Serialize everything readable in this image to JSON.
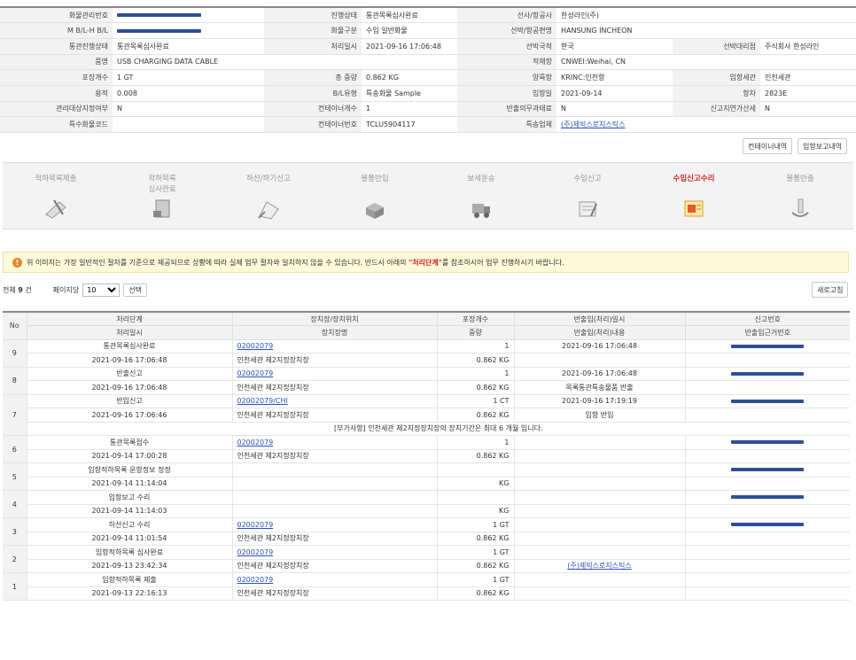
{
  "info": {
    "rows": [
      [
        {
          "l": "화물관리번호",
          "v": "",
          "redact": true
        },
        {
          "l": "진행상태",
          "v": "통관목록심사완료"
        },
        {
          "l": "선사/항공사",
          "v": "한성라인(주)",
          "span": 3
        }
      ],
      [
        {
          "l": "M B/L-H B/L",
          "v": "",
          "redact": true
        },
        {
          "l": "화물구분",
          "v": "수입 일반화물"
        },
        {
          "l": "선박/항공편명",
          "v": "HANSUNG INCHEON",
          "span": 3
        }
      ],
      [
        {
          "l": "통관진행상태",
          "v": "통관목록심사완료"
        },
        {
          "l": "처리일시",
          "v": "2021-09-16 17:06:48"
        },
        {
          "l": "선박국적",
          "v": "한국"
        },
        {
          "l": "선박대리점",
          "v": "주식회사 한성라인"
        }
      ],
      [
        {
          "l": "품명",
          "v": "USB CHARGING DATA CABLE",
          "span": 3
        },
        {
          "l": "적재항",
          "v": "CNWEI:Weihai, CN",
          "span": 3
        }
      ],
      [
        {
          "l": "포장개수",
          "v": "1 GT"
        },
        {
          "l": "총 중량",
          "v": "0.862 KG"
        },
        {
          "l": "양륙항",
          "v": "KRINC:인천항"
        },
        {
          "l": "입항세관",
          "v": "인천세관"
        }
      ],
      [
        {
          "l": "용적",
          "v": "0.008"
        },
        {
          "l": "B/L유형",
          "v": "특송화물 Sample"
        },
        {
          "l": "입항일",
          "v": "2021-09-14"
        },
        {
          "l": "항차",
          "v": "2823E"
        }
      ],
      [
        {
          "l": "관리대상지정여부",
          "v": "N"
        },
        {
          "l": "컨테이너개수",
          "v": "1"
        },
        {
          "l": "반출의무과태료",
          "v": "N"
        },
        {
          "l": "신고지연가산세",
          "v": "N"
        }
      ],
      [
        {
          "l": "특수화물코드",
          "v": ""
        },
        {
          "l": "컨테이너번호",
          "v": "TCLU5904117"
        },
        {
          "l": "특송업체",
          "v": "(주)제빅스로지스틱스",
          "link": true,
          "span": 3
        }
      ]
    ]
  },
  "buttons": {
    "container": "컨테이너내역",
    "entry": "입항보고내역",
    "refresh": "새로고침",
    "select": "선택"
  },
  "steps": [
    {
      "label": "적하목록제출",
      "icon": "pen-paper-icon"
    },
    {
      "label": "적하목록\n심사완료",
      "icon": "document-stamp-icon"
    },
    {
      "label": "하선/하기신고",
      "icon": "hand-paper-icon"
    },
    {
      "label": "물품반입",
      "icon": "box-stack-icon"
    },
    {
      "label": "보세운송",
      "icon": "truck-icon"
    },
    {
      "label": "수입신고",
      "icon": "form-pen-icon"
    },
    {
      "label": "수입신고수리",
      "icon": "accepted-stamp-icon",
      "active": true
    },
    {
      "label": "물품반출",
      "icon": "hand-doc-icon"
    }
  ],
  "notice": {
    "prefix": "위 이미지는 가장 일반적인 절차를 기준으로 제공되므로 상황에 따라 실제 업무 절차와 일치하지 않을 수 있습니다. 반드시 아래의 ",
    "highlight": "\"처리단계\"",
    "suffix": "를 참조하시어 업무 진행하시기 바랍니다."
  },
  "pager": {
    "total_prefix": "전체",
    "total": "9",
    "total_suffix": "건",
    "per_page_label": "페이지당",
    "per_page": "10"
  },
  "grid": {
    "headers_top": [
      "No",
      "처리단계",
      "장치장/장치위치",
      "포장개수",
      "반출입(처리)일시",
      "신고번호"
    ],
    "headers_bottom": [
      "처리일시",
      "장치장명",
      "중량",
      "반출입(처리)내용",
      "반출입근거번호"
    ],
    "records": [
      {
        "no": "9",
        "stage": "통관목록심사완료",
        "time": "2021-09-16 17:06:48",
        "loc": "02002079",
        "locname": "인천세관 제2지정장치장",
        "pkg": "1",
        "weight": "0.862 KG",
        "io_time": "2021-09-16 17:06:48",
        "io_desc": "",
        "decl": true,
        "basis": ""
      },
      {
        "no": "8",
        "stage": "반출신고",
        "time": "2021-09-16 17:06:48",
        "loc": "02002079",
        "locname": "인천세관 제2지정장치장",
        "pkg": "1",
        "weight": "0.862 KG",
        "io_time": "2021-09-16 17:06:48",
        "io_desc": "목록통관특송물품 반출",
        "decl": true,
        "basis": "",
        "redact2": true
      },
      {
        "no": "7",
        "stage": "반입신고",
        "time": "2021-09-16 17:06:46",
        "loc": "02002079/CHI",
        "locname": "인천세관 제2지정장치장",
        "pkg": "1 CT",
        "weight": "0.862 KG",
        "io_time": "2021-09-16 17:19:19",
        "io_desc": "입항 반입",
        "decl": true,
        "basis": "",
        "redact2": true,
        "extra": "[부가사항] 인천세관 제2지정장치장의 장치기간은 최대 6 개월 입니다."
      },
      {
        "no": "6",
        "stage": "통관목록접수",
        "time": "2021-09-14 17:00:28",
        "loc": "02002079",
        "locname": "인천세관 제2지정장치장",
        "pkg": "1",
        "weight": "0.862 KG",
        "io_time": "",
        "io_desc": "",
        "decl": true,
        "basis": ""
      },
      {
        "no": "5",
        "stage": "입항적하목록 운항정보 정정",
        "time": "2021-09-14 11:14:04",
        "loc": "",
        "locname": "",
        "pkg": "",
        "weight": "KG",
        "io_time": "",
        "io_desc": "",
        "decl": true,
        "basis": ""
      },
      {
        "no": "4",
        "stage": "입항보고 수리",
        "time": "2021-09-14 11:14:03",
        "loc": "",
        "locname": "",
        "pkg": "",
        "weight": "KG",
        "io_time": "",
        "io_desc": "",
        "decl": true,
        "basis": ""
      },
      {
        "no": "3",
        "stage": "하선신고 수리",
        "time": "2021-09-14 11:01:54",
        "loc": "02002079",
        "locname": "인천세관 제2지정장치장",
        "pkg": "1 GT",
        "weight": "0.862 KG",
        "io_time": "",
        "io_desc": "",
        "decl": true,
        "basis": ""
      },
      {
        "no": "2",
        "stage": "입항적하목록 심사완료",
        "time": "2021-09-13 23:42:34",
        "loc": "02002079",
        "locname": "인천세관 제2지정장치장",
        "pkg": "1 GT",
        "weight": "0.862 KG",
        "io_time": "",
        "io_desc": "(주)제빅스로지스틱스",
        "io_link": true,
        "decl": false,
        "basis": ""
      },
      {
        "no": "1",
        "stage": "입항적하목록 제출",
        "time": "2021-09-13 22:16:13",
        "loc": "02002079",
        "locname": "인천세관 제2지정장치장",
        "pkg": "1 GT",
        "weight": "0.862 KG",
        "io_time": "",
        "io_desc": "",
        "decl": false,
        "basis": ""
      }
    ]
  }
}
